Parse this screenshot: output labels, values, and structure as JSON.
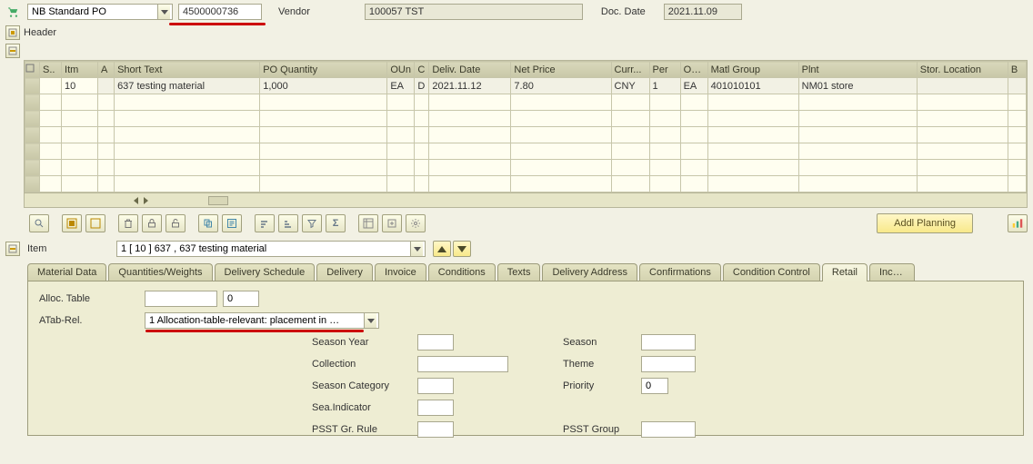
{
  "header": {
    "po_type": "NB Standard PO",
    "po_number": "4500000736",
    "vendor_label": "Vendor",
    "vendor_value": "100057 TST",
    "doc_date_label": "Doc. Date",
    "doc_date_value": "2021.11.09",
    "header_label": "Header"
  },
  "grid": {
    "columns": [
      "S..",
      "Itm",
      "A",
      "Short Text",
      "PO Quantity",
      "OUn",
      "C",
      "Deliv. Date",
      "Net Price",
      "Curr...",
      "Per",
      "OPU",
      "Matl Group",
      "Plnt",
      "Stor. Location",
      "B"
    ],
    "rows": [
      {
        "s": "",
        "itm": "10",
        "a": "",
        "short": "637 testing material",
        "qty": "1,000",
        "oun": "EA",
        "c": "D",
        "deliv": "2021.11.12",
        "net": "7.80",
        "curr": "CNY",
        "per": "1",
        "opu": "EA",
        "matl": "401010101",
        "plnt": "NM01 store",
        "stor": "",
        "b": ""
      },
      {
        "s": "",
        "itm": "",
        "a": "",
        "short": "",
        "qty": "",
        "oun": "",
        "c": "",
        "deliv": "",
        "net": "",
        "curr": "",
        "per": "",
        "opu": "",
        "matl": "",
        "plnt": "",
        "stor": "",
        "b": ""
      },
      {
        "s": "",
        "itm": "",
        "a": "",
        "short": "",
        "qty": "",
        "oun": "",
        "c": "",
        "deliv": "",
        "net": "",
        "curr": "",
        "per": "",
        "opu": "",
        "matl": "",
        "plnt": "",
        "stor": "",
        "b": ""
      },
      {
        "s": "",
        "itm": "",
        "a": "",
        "short": "",
        "qty": "",
        "oun": "",
        "c": "",
        "deliv": "",
        "net": "",
        "curr": "",
        "per": "",
        "opu": "",
        "matl": "",
        "plnt": "",
        "stor": "",
        "b": ""
      },
      {
        "s": "",
        "itm": "",
        "a": "",
        "short": "",
        "qty": "",
        "oun": "",
        "c": "",
        "deliv": "",
        "net": "",
        "curr": "",
        "per": "",
        "opu": "",
        "matl": "",
        "plnt": "",
        "stor": "",
        "b": ""
      },
      {
        "s": "",
        "itm": "",
        "a": "",
        "short": "",
        "qty": "",
        "oun": "",
        "c": "",
        "deliv": "",
        "net": "",
        "curr": "",
        "per": "",
        "opu": "",
        "matl": "",
        "plnt": "",
        "stor": "",
        "b": ""
      },
      {
        "s": "",
        "itm": "",
        "a": "",
        "short": "",
        "qty": "",
        "oun": "",
        "c": "",
        "deliv": "",
        "net": "",
        "curr": "",
        "per": "",
        "opu": "",
        "matl": "",
        "plnt": "",
        "stor": "",
        "b": ""
      }
    ]
  },
  "toolbar": {
    "addl_planning": "Addl Planning"
  },
  "item_section": {
    "label": "Item",
    "dropdown_value": "1 [ 10 ] 637 , 637 testing material"
  },
  "tabs": {
    "list": [
      "Material Data",
      "Quantities/Weights",
      "Delivery Schedule",
      "Delivery",
      "Invoice",
      "Conditions",
      "Texts",
      "Delivery Address",
      "Confirmations",
      "Condition Control",
      "Retail",
      "Incote"
    ],
    "active_index": 10
  },
  "retail": {
    "alloc_table_label": "Alloc. Table",
    "alloc_table_v1": "",
    "alloc_table_v2": "0",
    "atab_rel_label": "ATab-Rel.",
    "atab_rel_value": "1 Allocation-table-relevant: placement in …",
    "season_year_label": "Season Year",
    "season_year_value": "",
    "collection_label": "Collection",
    "collection_value": "",
    "season_category_label": "Season Category",
    "season_category_value": "",
    "sea_indicator_label": "Sea.Indicator",
    "sea_indicator_value": "",
    "psst_gr_rule_label": "PSST Gr. Rule",
    "psst_gr_rule_value": "",
    "season_label": "Season",
    "season_value": "",
    "theme_label": "Theme",
    "theme_value": "",
    "priority_label": "Priority",
    "priority_value": "0",
    "psst_group_label": "PSST Group",
    "psst_group_value": ""
  }
}
